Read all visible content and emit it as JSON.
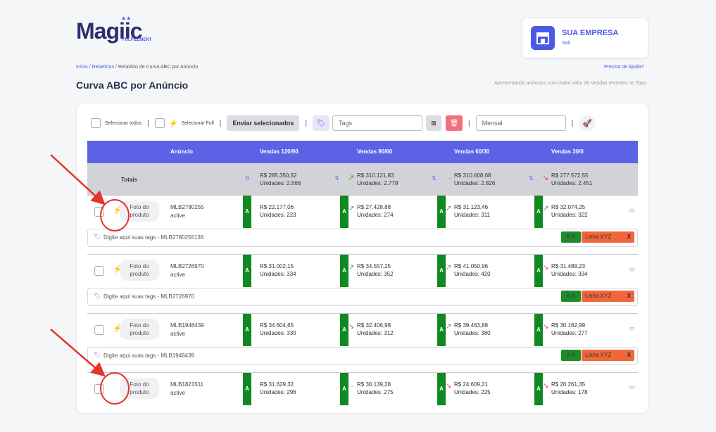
{
  "logo": {
    "word": "Magiic",
    "sub": "FULFILLMENT"
  },
  "company": {
    "name": "SUA EMPRESA",
    "logout": "Sair"
  },
  "breadcrumb": {
    "home": "Início",
    "sep1": " / ",
    "reports": "Relatórios",
    "sep2": " / ",
    "current": "Relatório de Curva ABC por Anúncio"
  },
  "help": "Precisa de Ajuda?",
  "title": "Curva ABC por Anúncio",
  "subtitle": "Apresentando anúncios com maior valor de Vendas recentes no Topo.",
  "toolbar": {
    "select_all": "Selecionar todos",
    "select_full": "Selecionar Full",
    "sep": "|",
    "send": "Enviar selecionados",
    "tags_placeholder": "Tags",
    "period": "Mensal"
  },
  "table": {
    "headers": [
      "Anúncio",
      "Vendas 120/90",
      "Vendas 90/60",
      "Vendas 60/30",
      "Vendas 30/0"
    ],
    "totals_label": "Totais",
    "totals": [
      {
        "value": "R$ 285.350,62",
        "units": "Unidades: 2.566",
        "trend": ""
      },
      {
        "value": "R$ 310.121,83",
        "units": "Unidades: 2.779",
        "trend": "up"
      },
      {
        "value": "R$ 310.608,68",
        "units": "Unidades: 2.826",
        "trend": "flat"
      },
      {
        "value": "R$ 277.572,55",
        "units": "Unidades: 2.451",
        "trend": "down"
      }
    ],
    "rows": [
      {
        "photo": "Foto do produto",
        "mlb": "MLB2780255",
        "status": "active",
        "full": true,
        "tag_placeholder": "Digite aqui suas tags - MLB2780255136",
        "cells": [
          {
            "abc": "A",
            "value": "R$ 22.177,06",
            "units": "Unidades: 223",
            "trend": ""
          },
          {
            "abc": "A",
            "value": "R$ 27.428,88",
            "units": "Unidades: 274",
            "trend": "up"
          },
          {
            "abc": "A",
            "value": "R$ 31.123,46",
            "units": "Unidades: 311",
            "trend": "up"
          },
          {
            "abc": "A",
            "value": "R$ 32.074,25",
            "units": "Unidades: 322",
            "trend": "up"
          }
        ],
        "chips": {
          "abc": "A  X",
          "line": "Linha XYZ",
          "close": "X"
        }
      },
      {
        "photo": "Foto do produto",
        "mlb": "MLB2726970",
        "status": "active",
        "full": true,
        "tag_placeholder": "Digite aqui suas tags - MLB2726970",
        "cells": [
          {
            "abc": "A",
            "value": "R$ 31.002,15",
            "units": "Unidades: 334",
            "trend": ""
          },
          {
            "abc": "A",
            "value": "R$ 34.557,25",
            "units": "Unidades: 352",
            "trend": "up"
          },
          {
            "abc": "A",
            "value": "R$ 41.050,96",
            "units": "Unidades: 420",
            "trend": "up"
          },
          {
            "abc": "A",
            "value": "R$ 31.489,23",
            "units": "Unidades: 334",
            "trend": "down"
          }
        ],
        "chips": {
          "abc": "A  X",
          "line": "Linha XYZ",
          "close": "X"
        }
      },
      {
        "photo": "Foto do produto",
        "mlb": "MLB1948439",
        "status": "active",
        "full": true,
        "tag_placeholder": "Digite aqui suas tags - MLB1948439",
        "cells": [
          {
            "abc": "A",
            "value": "R$ 34.604,65",
            "units": "Unidades: 330",
            "trend": ""
          },
          {
            "abc": "A",
            "value": "R$ 32.406,98",
            "units": "Unidades: 312",
            "trend": "down"
          },
          {
            "abc": "A",
            "value": "R$ 39.463,88",
            "units": "Unidades: 380",
            "trend": "up"
          },
          {
            "abc": "A",
            "value": "R$ 30.162,99",
            "units": "Unidades: 277",
            "trend": "down"
          }
        ],
        "chips": {
          "abc": "A  X",
          "line": "Linha XYZ",
          "close": "X"
        }
      },
      {
        "photo": "Foto do produto",
        "mlb": "MLB1821511",
        "status": "active",
        "full": false,
        "tag_placeholder": "",
        "cells": [
          {
            "abc": "A",
            "value": "R$ 31.629,32",
            "units": "Unidades: 296",
            "trend": ""
          },
          {
            "abc": "A",
            "value": "R$ 30.139,28",
            "units": "Unidades: 275",
            "trend": "flat"
          },
          {
            "abc": "A",
            "value": "R$ 24.609,21",
            "units": "Unidades: 225",
            "trend": "down"
          },
          {
            "abc": "A",
            "value": "R$ 20.261,35",
            "units": "Unidades: 178",
            "trend": "down"
          }
        ],
        "chips": null
      }
    ]
  },
  "colors": {
    "accent": "#5c62e6",
    "abc_green": "#108a20",
    "annotation_red": "#e8322e",
    "chip_orange": "#f2663a"
  }
}
